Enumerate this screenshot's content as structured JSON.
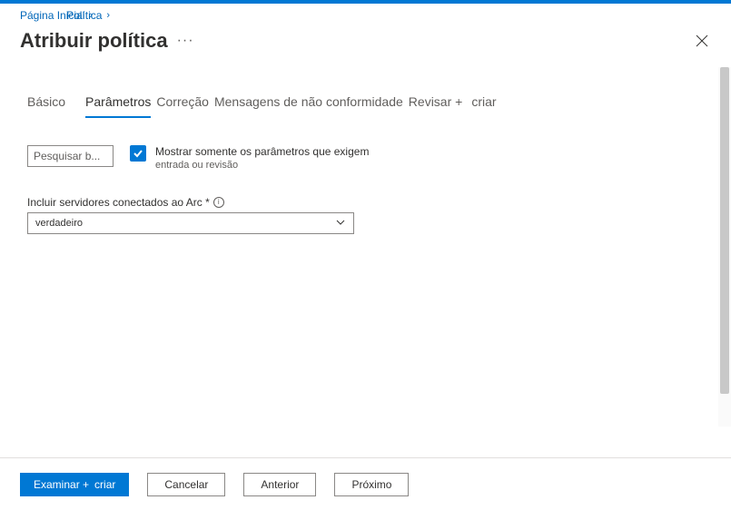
{
  "breadcrumb": {
    "home": "Página Inicial",
    "policy": "Política"
  },
  "header": {
    "title": "Atribuir política",
    "more": "···"
  },
  "tabs": {
    "basic": "Básico",
    "parameters": "Parâmetros",
    "remediation": "Correção",
    "noncompliance": "Mensagens de não conformidade",
    "review": "Revisar +",
    "create_suffix": "criar"
  },
  "search": {
    "placeholder": "Pesquisar b..."
  },
  "checkbox": {
    "label": "Mostrar somente os parâmetros que exigem",
    "sub": "entrada ou revisão"
  },
  "field": {
    "label": "Incluir servidores conectados ao Arc *",
    "value": "verdadeiro"
  },
  "footer": {
    "review_create": "Examinar +",
    "create_word": "criar",
    "cancel": "Cancelar",
    "previous": "Anterior",
    "next": "Próximo"
  }
}
